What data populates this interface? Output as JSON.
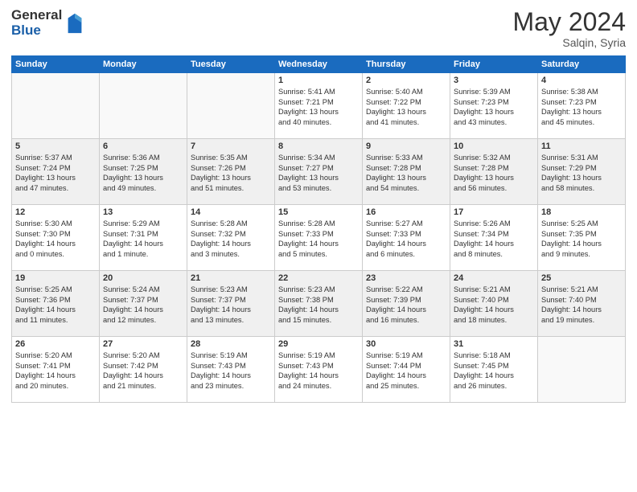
{
  "logo": {
    "general": "General",
    "blue": "Blue"
  },
  "header": {
    "month_year": "May 2024",
    "location": "Salqin, Syria"
  },
  "day_headers": [
    "Sunday",
    "Monday",
    "Tuesday",
    "Wednesday",
    "Thursday",
    "Friday",
    "Saturday"
  ],
  "weeks": [
    [
      {
        "day": "",
        "info": ""
      },
      {
        "day": "",
        "info": ""
      },
      {
        "day": "",
        "info": ""
      },
      {
        "day": "1",
        "info": "Sunrise: 5:41 AM\nSunset: 7:21 PM\nDaylight: 13 hours\nand 40 minutes."
      },
      {
        "day": "2",
        "info": "Sunrise: 5:40 AM\nSunset: 7:22 PM\nDaylight: 13 hours\nand 41 minutes."
      },
      {
        "day": "3",
        "info": "Sunrise: 5:39 AM\nSunset: 7:23 PM\nDaylight: 13 hours\nand 43 minutes."
      },
      {
        "day": "4",
        "info": "Sunrise: 5:38 AM\nSunset: 7:23 PM\nDaylight: 13 hours\nand 45 minutes."
      }
    ],
    [
      {
        "day": "5",
        "info": "Sunrise: 5:37 AM\nSunset: 7:24 PM\nDaylight: 13 hours\nand 47 minutes."
      },
      {
        "day": "6",
        "info": "Sunrise: 5:36 AM\nSunset: 7:25 PM\nDaylight: 13 hours\nand 49 minutes."
      },
      {
        "day": "7",
        "info": "Sunrise: 5:35 AM\nSunset: 7:26 PM\nDaylight: 13 hours\nand 51 minutes."
      },
      {
        "day": "8",
        "info": "Sunrise: 5:34 AM\nSunset: 7:27 PM\nDaylight: 13 hours\nand 53 minutes."
      },
      {
        "day": "9",
        "info": "Sunrise: 5:33 AM\nSunset: 7:28 PM\nDaylight: 13 hours\nand 54 minutes."
      },
      {
        "day": "10",
        "info": "Sunrise: 5:32 AM\nSunset: 7:28 PM\nDaylight: 13 hours\nand 56 minutes."
      },
      {
        "day": "11",
        "info": "Sunrise: 5:31 AM\nSunset: 7:29 PM\nDaylight: 13 hours\nand 58 minutes."
      }
    ],
    [
      {
        "day": "12",
        "info": "Sunrise: 5:30 AM\nSunset: 7:30 PM\nDaylight: 14 hours\nand 0 minutes."
      },
      {
        "day": "13",
        "info": "Sunrise: 5:29 AM\nSunset: 7:31 PM\nDaylight: 14 hours\nand 1 minute."
      },
      {
        "day": "14",
        "info": "Sunrise: 5:28 AM\nSunset: 7:32 PM\nDaylight: 14 hours\nand 3 minutes."
      },
      {
        "day": "15",
        "info": "Sunrise: 5:28 AM\nSunset: 7:33 PM\nDaylight: 14 hours\nand 5 minutes."
      },
      {
        "day": "16",
        "info": "Sunrise: 5:27 AM\nSunset: 7:33 PM\nDaylight: 14 hours\nand 6 minutes."
      },
      {
        "day": "17",
        "info": "Sunrise: 5:26 AM\nSunset: 7:34 PM\nDaylight: 14 hours\nand 8 minutes."
      },
      {
        "day": "18",
        "info": "Sunrise: 5:25 AM\nSunset: 7:35 PM\nDaylight: 14 hours\nand 9 minutes."
      }
    ],
    [
      {
        "day": "19",
        "info": "Sunrise: 5:25 AM\nSunset: 7:36 PM\nDaylight: 14 hours\nand 11 minutes."
      },
      {
        "day": "20",
        "info": "Sunrise: 5:24 AM\nSunset: 7:37 PM\nDaylight: 14 hours\nand 12 minutes."
      },
      {
        "day": "21",
        "info": "Sunrise: 5:23 AM\nSunset: 7:37 PM\nDaylight: 14 hours\nand 13 minutes."
      },
      {
        "day": "22",
        "info": "Sunrise: 5:23 AM\nSunset: 7:38 PM\nDaylight: 14 hours\nand 15 minutes."
      },
      {
        "day": "23",
        "info": "Sunrise: 5:22 AM\nSunset: 7:39 PM\nDaylight: 14 hours\nand 16 minutes."
      },
      {
        "day": "24",
        "info": "Sunrise: 5:21 AM\nSunset: 7:40 PM\nDaylight: 14 hours\nand 18 minutes."
      },
      {
        "day": "25",
        "info": "Sunrise: 5:21 AM\nSunset: 7:40 PM\nDaylight: 14 hours\nand 19 minutes."
      }
    ],
    [
      {
        "day": "26",
        "info": "Sunrise: 5:20 AM\nSunset: 7:41 PM\nDaylight: 14 hours\nand 20 minutes."
      },
      {
        "day": "27",
        "info": "Sunrise: 5:20 AM\nSunset: 7:42 PM\nDaylight: 14 hours\nand 21 minutes."
      },
      {
        "day": "28",
        "info": "Sunrise: 5:19 AM\nSunset: 7:43 PM\nDaylight: 14 hours\nand 23 minutes."
      },
      {
        "day": "29",
        "info": "Sunrise: 5:19 AM\nSunset: 7:43 PM\nDaylight: 14 hours\nand 24 minutes."
      },
      {
        "day": "30",
        "info": "Sunrise: 5:19 AM\nSunset: 7:44 PM\nDaylight: 14 hours\nand 25 minutes."
      },
      {
        "day": "31",
        "info": "Sunrise: 5:18 AM\nSunset: 7:45 PM\nDaylight: 14 hours\nand 26 minutes."
      },
      {
        "day": "",
        "info": ""
      }
    ]
  ]
}
